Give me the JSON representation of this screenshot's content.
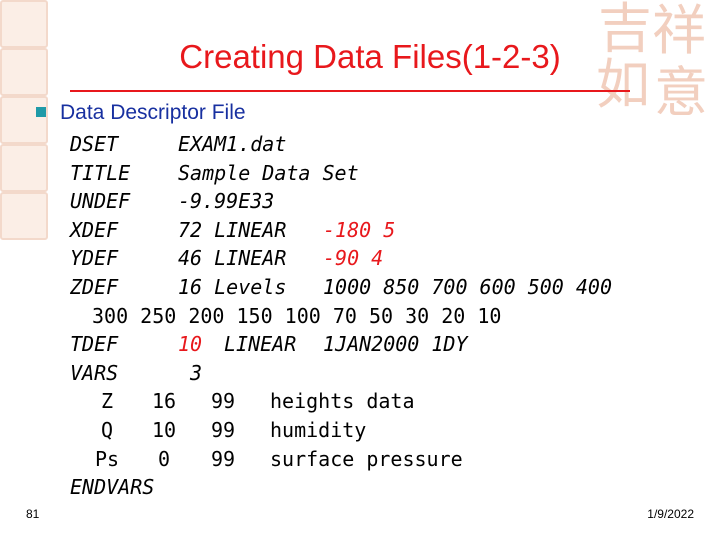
{
  "slide": {
    "title": "Creating Data Files(1-2-3)",
    "bullet": "Data Descriptor File",
    "lines": {
      "dset": {
        "key": "DSET",
        "value": "EXAM1.dat"
      },
      "title": {
        "key": "TITLE",
        "value": "Sample Data Set"
      },
      "undef": {
        "key": "UNDEF",
        "value": "-9.99E33"
      },
      "xdef": {
        "key": "XDEF",
        "kind": "72 LINEAR",
        "params": "-180 5"
      },
      "ydef": {
        "key": "YDEF",
        "kind": "46 LINEAR",
        "params": "-90 4"
      },
      "zdef": {
        "key": "ZDEF",
        "kind": "16 Levels",
        "params": "1000 850 700 600 500 400"
      },
      "zcont": "300 250 200 150 100 70 50 30 20 10",
      "tdef": {
        "key": "TDEF",
        "count": "10",
        "kind": "LINEAR",
        "params": "1JAN2000 1DY"
      },
      "vars": {
        "key": "VARS",
        "count": "3"
      },
      "variables": [
        {
          "name": "Z",
          "levels": "16",
          "units": "99",
          "desc": "heights data"
        },
        {
          "name": "Q",
          "levels": "10",
          "units": "99",
          "desc": "humidity"
        },
        {
          "name": "Ps",
          "levels": "0",
          "units": "99",
          "desc": "surface pressure"
        }
      ],
      "endvars": "ENDVARS"
    },
    "slide_number": "81",
    "date": "1/9/2022",
    "colors": {
      "title": "#e8181c",
      "bullet_text": "#1830a0",
      "bullet_marker": "#1f9aa8",
      "decoration": "#f2cfbf"
    }
  }
}
